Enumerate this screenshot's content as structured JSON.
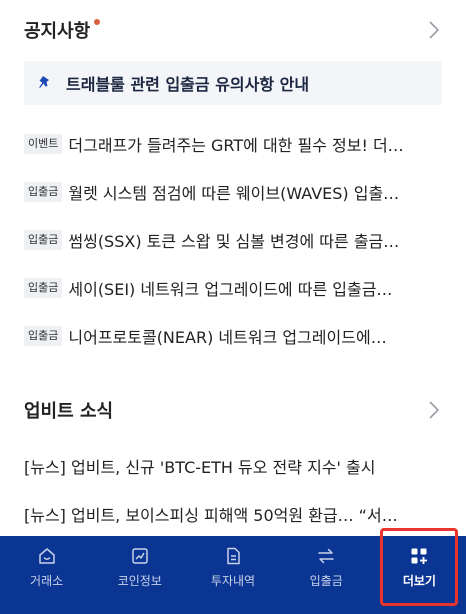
{
  "notices": {
    "title": "공지사항",
    "pinned": "트래블룰 관련 입출금 유의사항 안내",
    "items": [
      {
        "tag": "이벤트",
        "text": "더그래프가 들려주는 GRT에 대한 필수 정보! 더…"
      },
      {
        "tag": "입출금",
        "text": "월렛 시스템 점검에 따른 웨이브(WAVES) 입출…"
      },
      {
        "tag": "입출금",
        "text": "썸씽(SSX) 토큰 스왑 및 심볼 변경에 따른 출금…"
      },
      {
        "tag": "입출금",
        "text": "세이(SEI) 네트워크 업그레이드에 따른 입출금…"
      },
      {
        "tag": "입출금",
        "text": "니어프로토콜(NEAR) 네트워크 업그레이드에…"
      }
    ]
  },
  "news": {
    "title": "업비트 소식",
    "items": [
      "[뉴스] 업비트, 신규 'BTC-ETH 듀오 전략 지수' 출시",
      "[뉴스] 업비트, 보이스피싱 피해액 50억원 환급… “서…"
    ]
  },
  "nav": {
    "items": [
      {
        "label": "거래소",
        "icon": "exchange-icon"
      },
      {
        "label": "코인정보",
        "icon": "chart-icon"
      },
      {
        "label": "투자내역",
        "icon": "document-icon"
      },
      {
        "label": "입출금",
        "icon": "transfer-icon"
      },
      {
        "label": "더보기",
        "icon": "more-icon"
      }
    ],
    "active_index": 4
  },
  "colors": {
    "nav_background": "#0b3592",
    "accent_dot": "#d9603f",
    "highlight": "#e8332f",
    "pinned_background": "#f3f5f9"
  }
}
